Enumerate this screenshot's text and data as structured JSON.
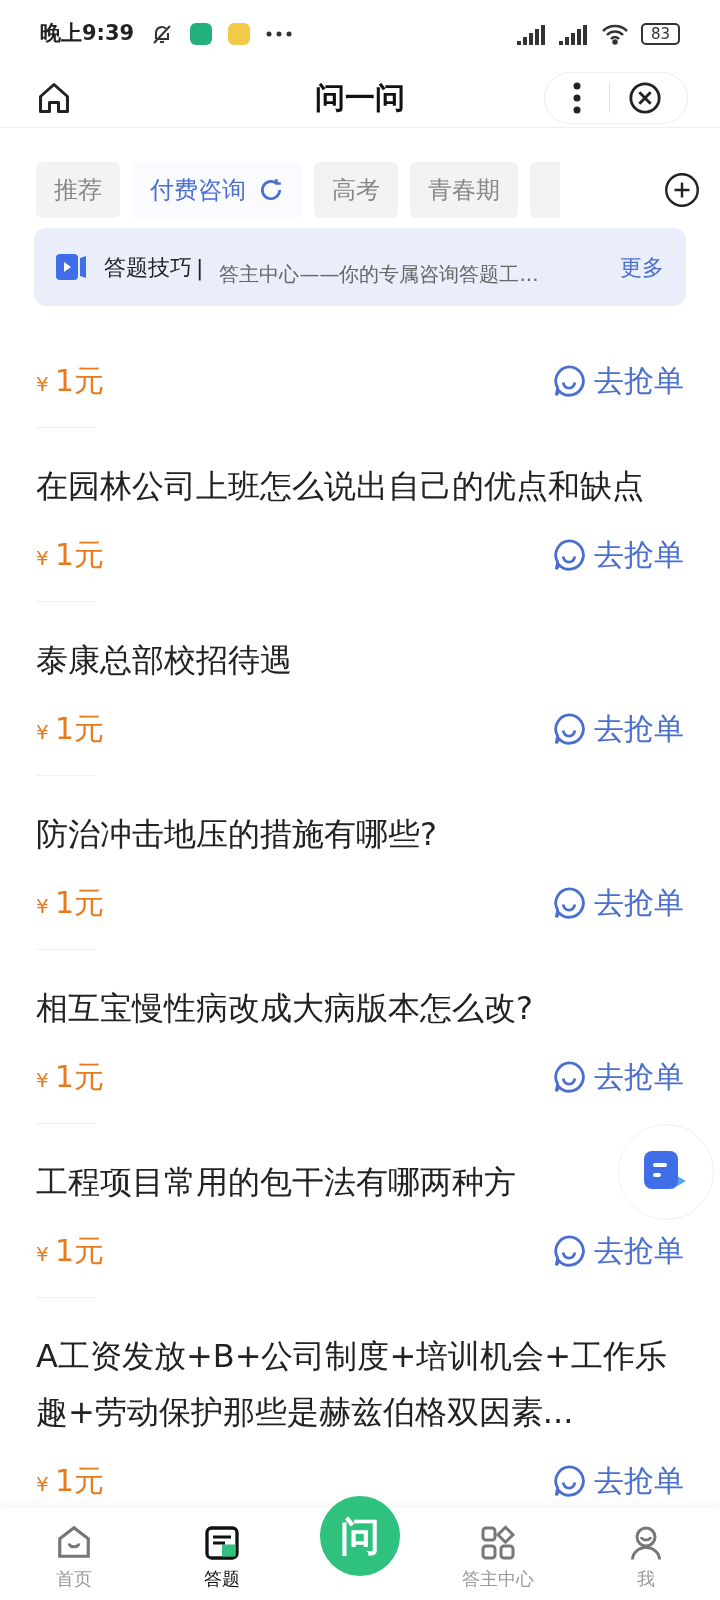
{
  "status_bar": {
    "time": "晚上9:39",
    "battery": "83"
  },
  "header": {
    "title": "问一问"
  },
  "tabs": [
    {
      "label": "推荐",
      "selected": false,
      "refresh": false
    },
    {
      "label": "付费咨询",
      "selected": true,
      "refresh": true
    },
    {
      "label": "高考",
      "selected": false,
      "refresh": false
    },
    {
      "label": "青春期",
      "selected": false,
      "refresh": false
    }
  ],
  "notice": {
    "label": "答题技巧",
    "separator": "|",
    "text": "答主中心——你的专属咨询答题工...",
    "more": "更多"
  },
  "questions": [
    {
      "price": "1元",
      "currency": "¥",
      "action": "去抢单"
    },
    {
      "question": "在园林公司上班怎么说出自己的优点和缺点",
      "price": "1元",
      "currency": "¥",
      "action": "去抢单"
    },
    {
      "question": "泰康总部校招待遇",
      "price": "1元",
      "currency": "¥",
      "action": "去抢单"
    },
    {
      "question": "防治冲击地压的措施有哪些?",
      "price": "1元",
      "currency": "¥",
      "action": "去抢单"
    },
    {
      "question": "相互宝慢性病改成大病版本怎么改?",
      "price": "1元",
      "currency": "¥",
      "action": "去抢单"
    },
    {
      "question": "工程项目常用的包干法有哪两种方",
      "price": "1元",
      "currency": "¥",
      "action": "去抢单"
    },
    {
      "question": "A工资发放+B+公司制度+培训机会+工作乐趣+劳动保护那些是赫兹伯格双因素...",
      "price": "1元",
      "currency": "¥",
      "action": "去抢单"
    }
  ],
  "bottom_nav": [
    {
      "kind": "home",
      "label": "首页",
      "selected": false
    },
    {
      "kind": "answer",
      "label": "答题",
      "selected": true
    },
    {
      "kind": "ask",
      "label": "问",
      "selected": false
    },
    {
      "kind": "center",
      "label": "答主中心",
      "selected": false
    },
    {
      "kind": "me",
      "label": "我",
      "selected": false
    }
  ]
}
